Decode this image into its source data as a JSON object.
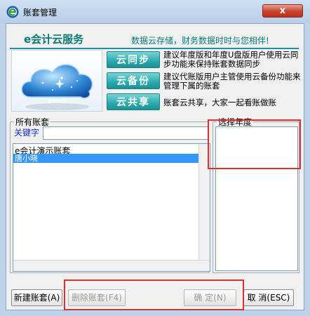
{
  "window": {
    "title": "账套管理",
    "close_glyph": "x"
  },
  "header": {
    "brand": "e会计云服务",
    "slogan": "数据云存储，财务数据时时与您相伴!"
  },
  "cloud_panel": {
    "caption": "CLOUD"
  },
  "services": [
    {
      "label": "云同步",
      "desc": "建议年度版和年度U盘版用户使用云同步功能来保持账套数据同步"
    },
    {
      "label": "云备份",
      "desc": "建议代账版用户主管使用云备份功能来管理下属的账套"
    },
    {
      "label": "云共享",
      "desc": "账套云共享，大家一起看账做账"
    }
  ],
  "accounts": {
    "group_title": "所有账套",
    "keyword_label": "关键字",
    "keyword_value": "",
    "items": [
      "e会计演示账套",
      "唐小晓"
    ]
  },
  "year": {
    "group_title": "选择年度",
    "items": []
  },
  "buttons": {
    "new": "新建账套(A)",
    "delete": "删除账套(F4)",
    "ok": "确 定(N)",
    "cancel": "取 消(ESC)"
  },
  "colors": {
    "accent": "#0a7a74",
    "service_button": "#2aa9ad",
    "selection": "#3399ff",
    "highlight": "#e03030"
  }
}
